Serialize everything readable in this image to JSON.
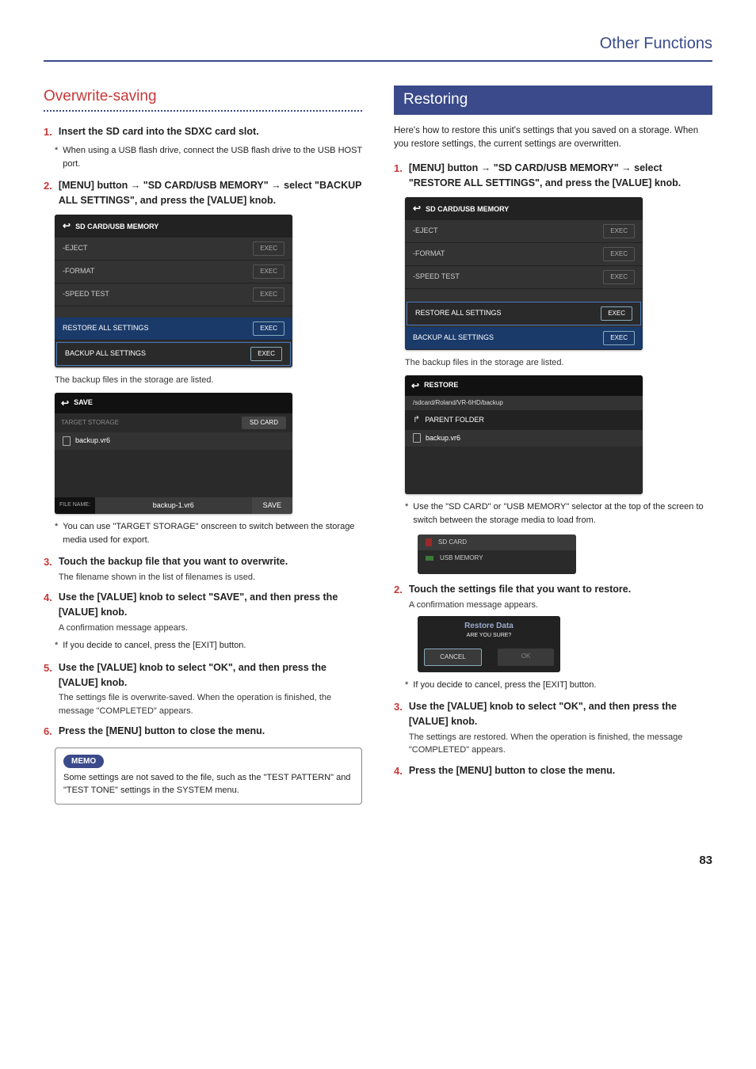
{
  "header": {
    "category": "Other Functions"
  },
  "pageNumber": "83",
  "left": {
    "title": "Overwrite-saving",
    "steps": {
      "s1": {
        "title": "Insert the SD card into the SDXC card slot.",
        "note": "When using a USB flash drive, connect the USB flash drive to the USB HOST port."
      },
      "s2": {
        "pre": "[MENU] button ",
        "mid": " \"SD CARD/USB MEMORY\" ",
        "post": " select \"BACKUP ALL SETTINGS\", and press the [VALUE] knob."
      },
      "s2_caption": "The backup files in the storage are listed.",
      "s2_note": "You can use \"TARGET STORAGE\" onscreen to switch between the storage media used for export.",
      "s3": {
        "title": "Touch the backup file that you want to overwrite.",
        "sub": "The filename shown in the list of filenames is used."
      },
      "s4": {
        "title": "Use the [VALUE] knob to select \"SAVE\", and then press the [VALUE] knob.",
        "sub": "A confirmation message appears.",
        "note": "If you decide to cancel, press the [EXIT] button."
      },
      "s5": {
        "title": "Use the [VALUE] knob to select \"OK\", and then press the [VALUE] knob.",
        "sub": "The settings file is overwrite-saved. When the operation is finished, the message \"COMPLETED\" appears."
      },
      "s6": {
        "title": "Press the [MENU] button to close the menu."
      }
    },
    "memo": {
      "label": "MEMO",
      "text": "Some settings are not saved to the file, such as the \"TEST PATTERN\" and \"TEST TONE\" settings in the SYSTEM menu."
    },
    "ui_sd": {
      "header": "SD CARD/USB MEMORY",
      "rows": [
        {
          "label": "-EJECT",
          "btn": "EXEC"
        },
        {
          "label": "-FORMAT",
          "btn": "EXEC"
        },
        {
          "label": "-SPEED TEST",
          "btn": "EXEC"
        }
      ],
      "hl1": {
        "label": "RESTORE ALL SETTINGS",
        "btn": "EXEC"
      },
      "hl2": {
        "label": "BACKUP ALL SETTINGS",
        "btn": "EXEC"
      }
    },
    "ui_save": {
      "header": "SAVE",
      "target_label": "TARGET STORAGE",
      "target_value": "SD CARD",
      "file": "backup.vr6",
      "filename_label": "FILE NAME:",
      "filename_value": "backup-1.vr6",
      "save_btn": "SAVE"
    }
  },
  "right": {
    "title": "Restoring",
    "intro": "Here's how to restore this unit's settings that you saved on a storage. When you restore settings, the current settings are overwritten.",
    "steps": {
      "s1": {
        "pre": "[MENU] button ",
        "mid": " \"SD CARD/USB MEMORY\" ",
        "post": " select \"RESTORE ALL SETTINGS\", and press the [VALUE] knob."
      },
      "s1_caption": "The backup files in the storage are listed.",
      "s1_note": "Use the \"SD CARD\" or \"USB MEMORY\" selector at the top of the screen to switch between the storage media to load from.",
      "s2": {
        "title": "Touch the settings file that you want to restore.",
        "sub": "A confirmation message appears.",
        "note": "If you decide to cancel, press the [EXIT] button."
      },
      "s3": {
        "title": "Use the [VALUE] knob to select \"OK\", and then press the [VALUE] knob.",
        "sub": "The settings are restored. When the operation is finished, the message \"COMPLETED\" appears."
      },
      "s4": {
        "title": "Press the [MENU] button to close the menu."
      }
    },
    "ui_sd": {
      "header": "SD CARD/USB MEMORY",
      "rows": [
        {
          "label": "-EJECT",
          "btn": "EXEC"
        },
        {
          "label": "-FORMAT",
          "btn": "EXEC"
        },
        {
          "label": "-SPEED TEST",
          "btn": "EXEC"
        }
      ],
      "hl1": {
        "label": "RESTORE ALL SETTINGS",
        "btn": "EXEC"
      },
      "hl2": {
        "label": "BACKUP ALL SETTINGS",
        "btn": "EXEC"
      }
    },
    "ui_restore": {
      "header": "RESTORE",
      "path": "/sdcard/Roland/VR-6HD/backup",
      "parent": "PARENT FOLDER",
      "file": "backup.vr6"
    },
    "selector": {
      "sd": "SD CARD",
      "usb": "USB MEMORY"
    },
    "dialog": {
      "title": "Restore Data",
      "sub": "ARE YOU SURE?",
      "cancel": "CANCEL",
      "ok": "OK"
    }
  }
}
